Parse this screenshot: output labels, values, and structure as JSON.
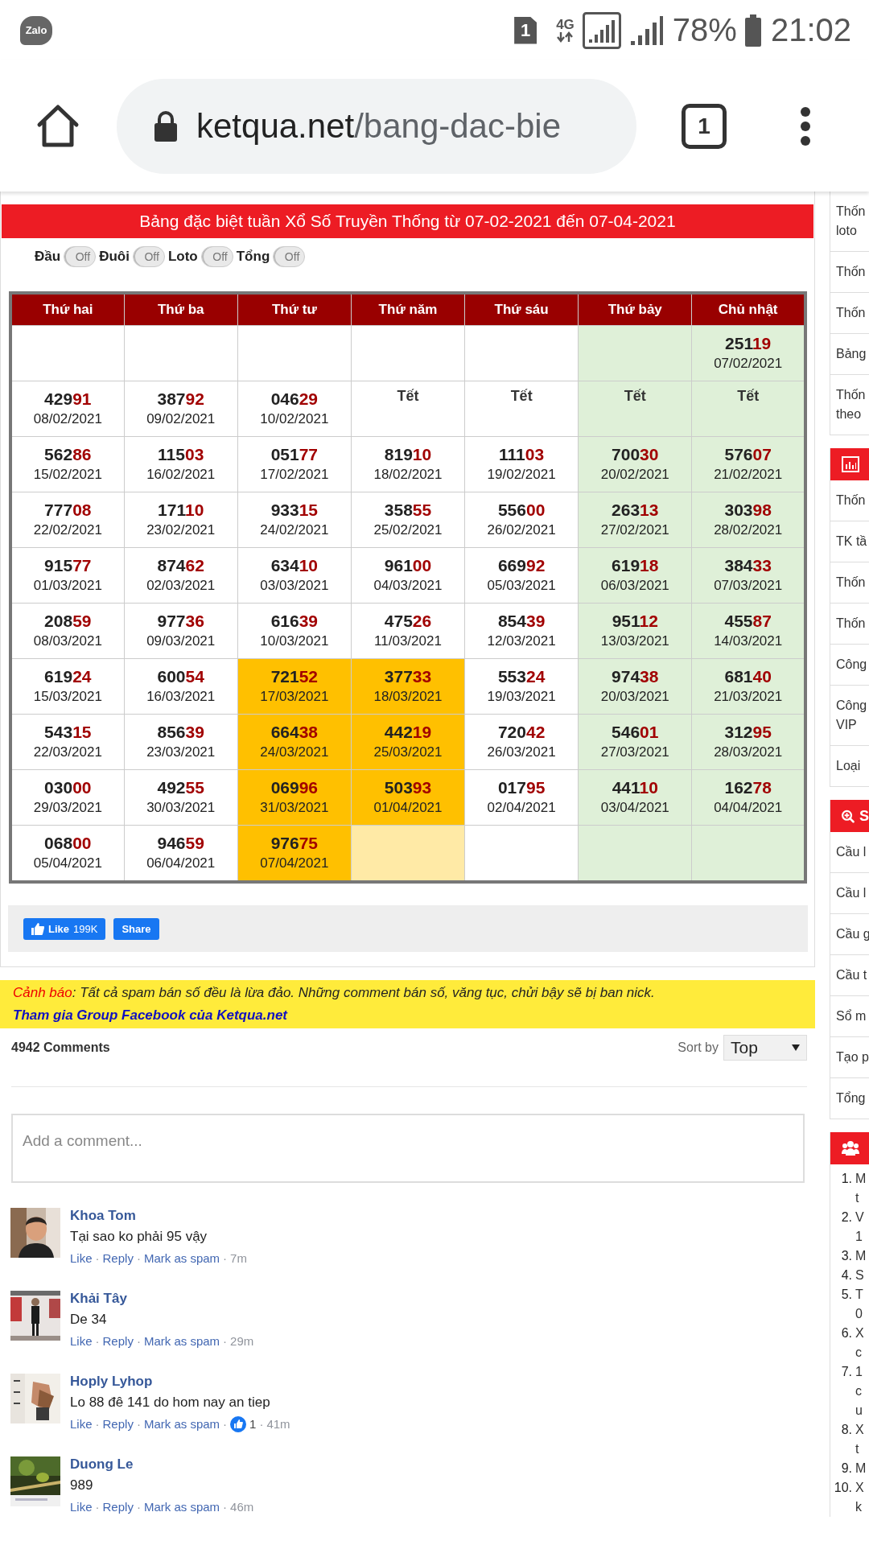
{
  "status_bar": {
    "app_icon_label": "Zalo",
    "sim_label": "1",
    "network": "4G",
    "battery": "78%",
    "time": "21:02"
  },
  "browser": {
    "url_host": "ketqua.net",
    "url_path": "/bang-dac-bie",
    "tab_count": "1"
  },
  "title": "Bảng đặc biệt tuần Xổ Số Truyền Thống từ 07-02-2021 đến 07-04-2021",
  "toggles": [
    {
      "label": "Đầu",
      "state": "Off",
      "on": false
    },
    {
      "label": "Đuôi",
      "state": "Off",
      "on": false
    },
    {
      "label": "Loto",
      "state": "Off",
      "on": false
    },
    {
      "label": "Tổng",
      "state": "Off",
      "on": false
    }
  ],
  "table": {
    "columns": [
      "Thứ hai",
      "Thứ ba",
      "Thứ tư",
      "Thứ năm",
      "Thứ sáu",
      "Thứ bảy",
      "Chủ nhật"
    ],
    "rows": [
      [
        {
          "kind": "empty",
          "color": "#ffffff"
        },
        {
          "kind": "empty",
          "color": "#ffffff"
        },
        {
          "kind": "empty",
          "color": "#ffffff"
        },
        {
          "kind": "empty",
          "color": "#ffffff"
        },
        {
          "kind": "empty",
          "color": "#ffffff"
        },
        {
          "kind": "empty",
          "color": "#dff0d8"
        },
        {
          "kind": "result",
          "head": "251",
          "tail": "19",
          "date": "07/02/2021",
          "color": "#dff0d8"
        }
      ],
      [
        {
          "kind": "result",
          "head": "429",
          "tail": "91",
          "date": "08/02/2021",
          "color": "#ffffff"
        },
        {
          "kind": "result",
          "head": "387",
          "tail": "92",
          "date": "09/02/2021",
          "color": "#ffffff"
        },
        {
          "kind": "result",
          "head": "046",
          "tail": "29",
          "date": "10/02/2021",
          "color": "#ffffff"
        },
        {
          "kind": "holiday",
          "text": "Tết",
          "color": "#ffffff"
        },
        {
          "kind": "holiday",
          "text": "Tết",
          "color": "#ffffff"
        },
        {
          "kind": "holiday",
          "text": "Tết",
          "color": "#dff0d8"
        },
        {
          "kind": "holiday",
          "text": "Tết",
          "color": "#dff0d8"
        }
      ],
      [
        {
          "kind": "result",
          "head": "562",
          "tail": "86",
          "date": "15/02/2021",
          "color": "#ffffff"
        },
        {
          "kind": "result",
          "head": "115",
          "tail": "03",
          "date": "16/02/2021",
          "color": "#ffffff"
        },
        {
          "kind": "result",
          "head": "051",
          "tail": "77",
          "date": "17/02/2021",
          "color": "#ffffff"
        },
        {
          "kind": "result",
          "head": "819",
          "tail": "10",
          "date": "18/02/2021",
          "color": "#ffffff"
        },
        {
          "kind": "result",
          "head": "111",
          "tail": "03",
          "date": "19/02/2021",
          "color": "#ffffff"
        },
        {
          "kind": "result",
          "head": "700",
          "tail": "30",
          "date": "20/02/2021",
          "color": "#dff0d8"
        },
        {
          "kind": "result",
          "head": "576",
          "tail": "07",
          "date": "21/02/2021",
          "color": "#dff0d8"
        }
      ],
      [
        {
          "kind": "result",
          "head": "777",
          "tail": "08",
          "date": "22/02/2021",
          "color": "#ffffff"
        },
        {
          "kind": "result",
          "head": "171",
          "tail": "10",
          "date": "23/02/2021",
          "color": "#ffffff"
        },
        {
          "kind": "result",
          "head": "933",
          "tail": "15",
          "date": "24/02/2021",
          "color": "#ffffff"
        },
        {
          "kind": "result",
          "head": "358",
          "tail": "55",
          "date": "25/02/2021",
          "color": "#ffffff"
        },
        {
          "kind": "result",
          "head": "556",
          "tail": "00",
          "date": "26/02/2021",
          "color": "#ffffff"
        },
        {
          "kind": "result",
          "head": "263",
          "tail": "13",
          "date": "27/02/2021",
          "color": "#dff0d8"
        },
        {
          "kind": "result",
          "head": "303",
          "tail": "98",
          "date": "28/02/2021",
          "color": "#dff0d8"
        }
      ],
      [
        {
          "kind": "result",
          "head": "915",
          "tail": "77",
          "date": "01/03/2021",
          "color": "#ffffff"
        },
        {
          "kind": "result",
          "head": "874",
          "tail": "62",
          "date": "02/03/2021",
          "color": "#ffffff"
        },
        {
          "kind": "result",
          "head": "634",
          "tail": "10",
          "date": "03/03/2021",
          "color": "#ffffff"
        },
        {
          "kind": "result",
          "head": "961",
          "tail": "00",
          "date": "04/03/2021",
          "color": "#ffffff"
        },
        {
          "kind": "result",
          "head": "669",
          "tail": "92",
          "date": "05/03/2021",
          "color": "#ffffff"
        },
        {
          "kind": "result",
          "head": "619",
          "tail": "18",
          "date": "06/03/2021",
          "color": "#dff0d8"
        },
        {
          "kind": "result",
          "head": "384",
          "tail": "33",
          "date": "07/03/2021",
          "color": "#dff0d8"
        }
      ],
      [
        {
          "kind": "result",
          "head": "208",
          "tail": "59",
          "date": "08/03/2021",
          "color": "#ffffff"
        },
        {
          "kind": "result",
          "head": "977",
          "tail": "36",
          "date": "09/03/2021",
          "color": "#ffffff"
        },
        {
          "kind": "result",
          "head": "616",
          "tail": "39",
          "date": "10/03/2021",
          "color": "#ffffff"
        },
        {
          "kind": "result",
          "head": "475",
          "tail": "26",
          "date": "11/03/2021",
          "color": "#ffffff"
        },
        {
          "kind": "result",
          "head": "854",
          "tail": "39",
          "date": "12/03/2021",
          "color": "#ffffff"
        },
        {
          "kind": "result",
          "head": "951",
          "tail": "12",
          "date": "13/03/2021",
          "color": "#dff0d8"
        },
        {
          "kind": "result",
          "head": "455",
          "tail": "87",
          "date": "14/03/2021",
          "color": "#dff0d8"
        }
      ],
      [
        {
          "kind": "result",
          "head": "619",
          "tail": "24",
          "date": "15/03/2021",
          "color": "#ffffff"
        },
        {
          "kind": "result",
          "head": "600",
          "tail": "54",
          "date": "16/03/2021",
          "color": "#ffffff"
        },
        {
          "kind": "result",
          "head": "721",
          "tail": "52",
          "date": "17/03/2021",
          "color": "#ffc000"
        },
        {
          "kind": "result",
          "head": "377",
          "tail": "33",
          "date": "18/03/2021",
          "color": "#ffc000"
        },
        {
          "kind": "result",
          "head": "553",
          "tail": "24",
          "date": "19/03/2021",
          "color": "#ffffff"
        },
        {
          "kind": "result",
          "head": "974",
          "tail": "38",
          "date": "20/03/2021",
          "color": "#dff0d8"
        },
        {
          "kind": "result",
          "head": "681",
          "tail": "40",
          "date": "21/03/2021",
          "color": "#dff0d8"
        }
      ],
      [
        {
          "kind": "result",
          "head": "543",
          "tail": "15",
          "date": "22/03/2021",
          "color": "#ffffff"
        },
        {
          "kind": "result",
          "head": "856",
          "tail": "39",
          "date": "23/03/2021",
          "color": "#ffffff"
        },
        {
          "kind": "result",
          "head": "664",
          "tail": "38",
          "date": "24/03/2021",
          "color": "#ffc000"
        },
        {
          "kind": "result",
          "head": "442",
          "tail": "19",
          "date": "25/03/2021",
          "color": "#ffc000"
        },
        {
          "kind": "result",
          "head": "720",
          "tail": "42",
          "date": "26/03/2021",
          "color": "#ffffff"
        },
        {
          "kind": "result",
          "head": "546",
          "tail": "01",
          "date": "27/03/2021",
          "color": "#dff0d8"
        },
        {
          "kind": "result",
          "head": "312",
          "tail": "95",
          "date": "28/03/2021",
          "color": "#dff0d8"
        }
      ],
      [
        {
          "kind": "result",
          "head": "030",
          "tail": "00",
          "date": "29/03/2021",
          "color": "#ffffff"
        },
        {
          "kind": "result",
          "head": "492",
          "tail": "55",
          "date": "30/03/2021",
          "color": "#ffffff"
        },
        {
          "kind": "result",
          "head": "069",
          "tail": "96",
          "date": "31/03/2021",
          "color": "#ffc000"
        },
        {
          "kind": "result",
          "head": "503",
          "tail": "93",
          "date": "01/04/2021",
          "color": "#ffc000"
        },
        {
          "kind": "result",
          "head": "017",
          "tail": "95",
          "date": "02/04/2021",
          "color": "#ffffff"
        },
        {
          "kind": "result",
          "head": "441",
          "tail": "10",
          "date": "03/04/2021",
          "color": "#dff0d8"
        },
        {
          "kind": "result",
          "head": "162",
          "tail": "78",
          "date": "04/04/2021",
          "color": "#dff0d8"
        }
      ],
      [
        {
          "kind": "result",
          "head": "068",
          "tail": "00",
          "date": "05/04/2021",
          "color": "#ffffff"
        },
        {
          "kind": "result",
          "head": "946",
          "tail": "59",
          "date": "06/04/2021",
          "color": "#ffffff"
        },
        {
          "kind": "result",
          "head": "976",
          "tail": "75",
          "date": "07/04/2021",
          "color": "#ffc000"
        },
        {
          "kind": "empty",
          "color": "#ffeaa6"
        },
        {
          "kind": "empty",
          "color": "#ffffff"
        },
        {
          "kind": "empty",
          "color": "#dff0d8"
        },
        {
          "kind": "empty",
          "color": "#dff0d8"
        }
      ]
    ]
  },
  "like_button": {
    "label": "Like",
    "count": "199K"
  },
  "share_button": {
    "label": "Share"
  },
  "warning": {
    "label": "Cảnh báo",
    "text": ": Tất cả spam bán số đều là lừa đảo. Những comment bán số, văng tục, chửi bậy sẽ bị ban nick.",
    "link": "Tham gia Group Facebook của Ketqua.net"
  },
  "comments": {
    "count": "4942 Comments",
    "sort_label": "Sort by",
    "sort_value": "Top",
    "placeholder": "Add a comment...",
    "separator": "·",
    "items": [
      {
        "author": "Khoa Tom",
        "text": "Tại sao ko phải 95 vậy",
        "actions": [
          "Like",
          "Reply",
          "Mark as spam"
        ],
        "time": "7m"
      },
      {
        "author": "Khải Tây",
        "text": "De 34",
        "actions": [
          "Like",
          "Reply",
          "Mark as spam"
        ],
        "time": "29m"
      },
      {
        "author": "Hoply Lyhop",
        "text": "Lo 88 đê 141 do hom nay an tiep",
        "actions": [
          "Like",
          "Reply",
          "Mark as spam"
        ],
        "reactions": "1",
        "time": "41m"
      },
      {
        "author": "Duong Le",
        "text": "989",
        "actions": [
          "Like",
          "Reply",
          "Mark as spam"
        ],
        "time": "46m"
      }
    ]
  },
  "sidebar": [
    {
      "kind": "plain",
      "items": [
        "Thốn\nloto",
        "Thốn",
        "Thốn",
        "Bảng",
        "Thốn\ntheo"
      ]
    },
    {
      "kind": "stats",
      "items": [
        "Thốn",
        "TK tầ",
        "Thốn",
        "Thốn",
        "Công",
        "Công\nVIP",
        "Loại"
      ]
    },
    {
      "kind": "search",
      "title": "S",
      "items": [
        "Cầu l",
        "Cầu l",
        "Cầu g",
        "Cầu t",
        "Sổ m",
        "Tạo p",
        "Tổng"
      ]
    },
    {
      "kind": "members",
      "list": [
        {
          "number": "1.",
          "text": "M\nt"
        },
        {
          "number": "2.",
          "text": "V\n1"
        },
        {
          "number": "3.",
          "text": "M"
        },
        {
          "number": "4.",
          "text": "S"
        },
        {
          "number": "5.",
          "text": "T\n0"
        },
        {
          "number": "6.",
          "text": "X\nc"
        },
        {
          "number": "7.",
          "text": "1\nc\nu"
        },
        {
          "number": "8.",
          "text": "X\nt"
        },
        {
          "number": "9.",
          "text": "M"
        },
        {
          "number": "10.",
          "text": "X\nk"
        }
      ]
    }
  ]
}
